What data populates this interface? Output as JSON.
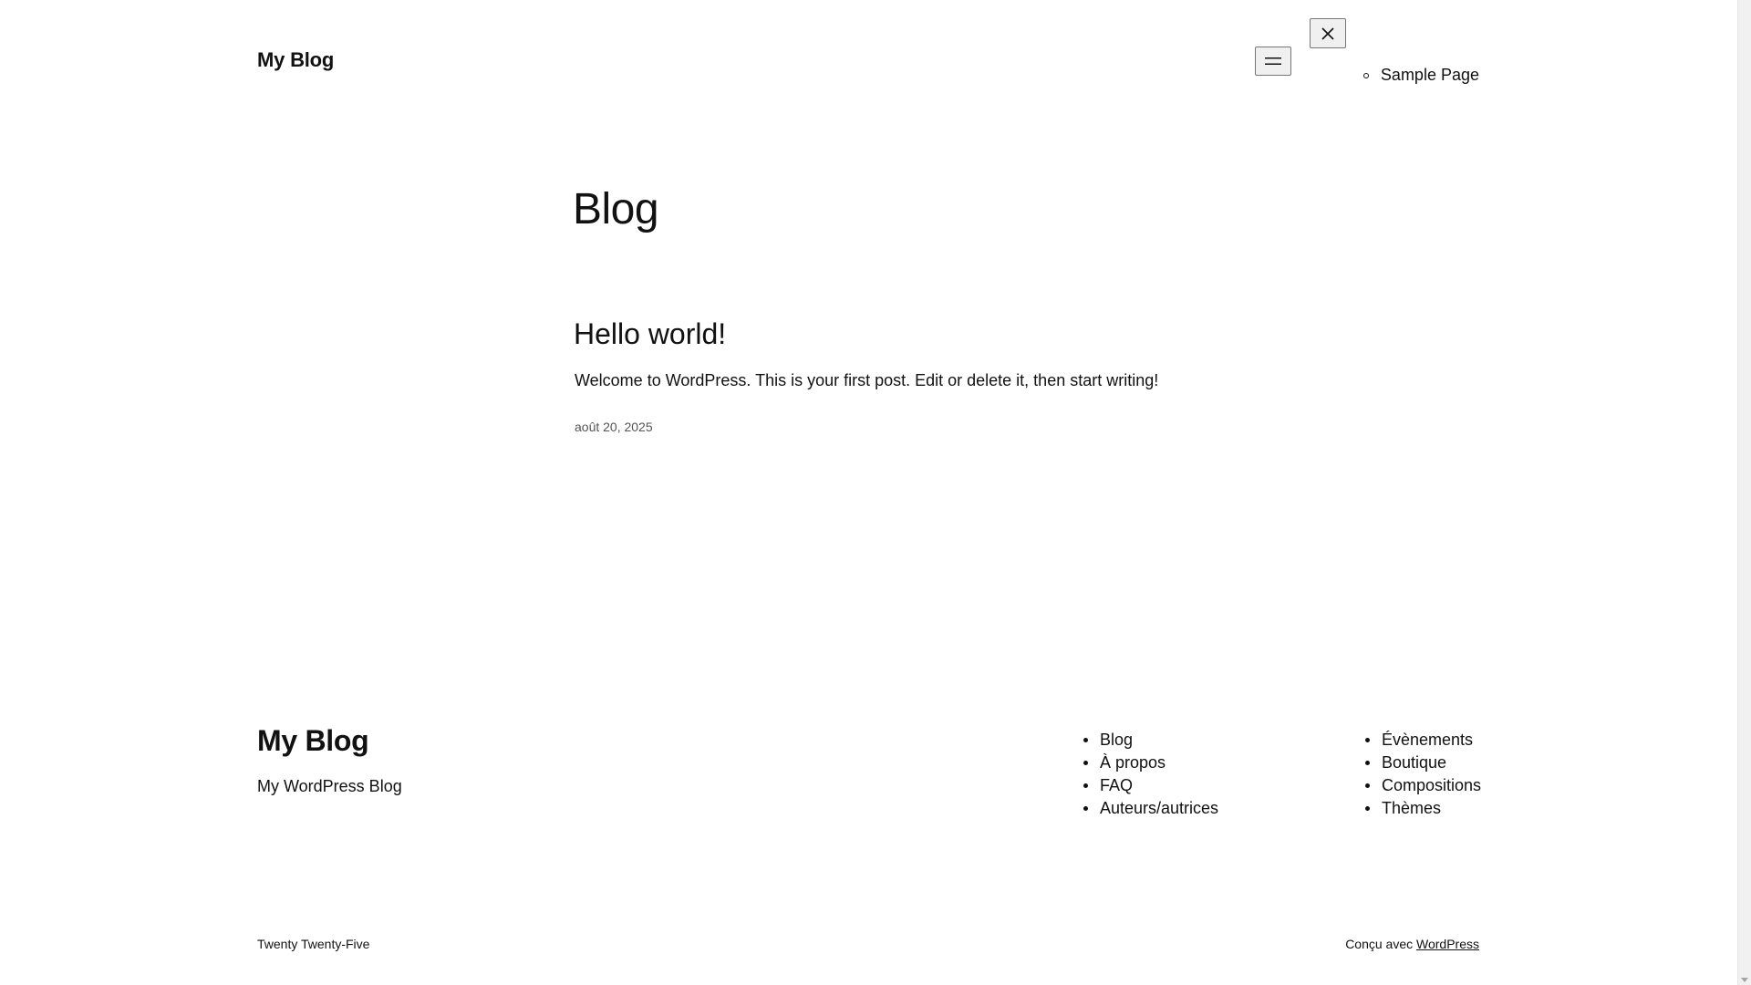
{
  "header": {
    "site_title": "My Blog",
    "menu_icon": "menu-icon",
    "close_icon": "close-icon",
    "nav_items": [
      "Sample Page"
    ]
  },
  "main": {
    "page_heading": "Blog",
    "post": {
      "title": "Hello world!",
      "excerpt": "Welcome to WordPress. This is your first post. Edit or delete it, then start writing!",
      "date": "août 20, 2025"
    }
  },
  "footer": {
    "site_title": "My Blog",
    "tagline": "My WordPress Blog",
    "nav_col1": [
      "Blog",
      "À propos",
      "FAQ",
      "Auteurs/autrices"
    ],
    "nav_col2": [
      "Évènements",
      "Boutique",
      "Compositions",
      "Thèmes"
    ],
    "credit_left": "Twenty Twenty-Five",
    "credit_right_prefix": "Conçu avec",
    "credit_right_link": "WordPress"
  }
}
